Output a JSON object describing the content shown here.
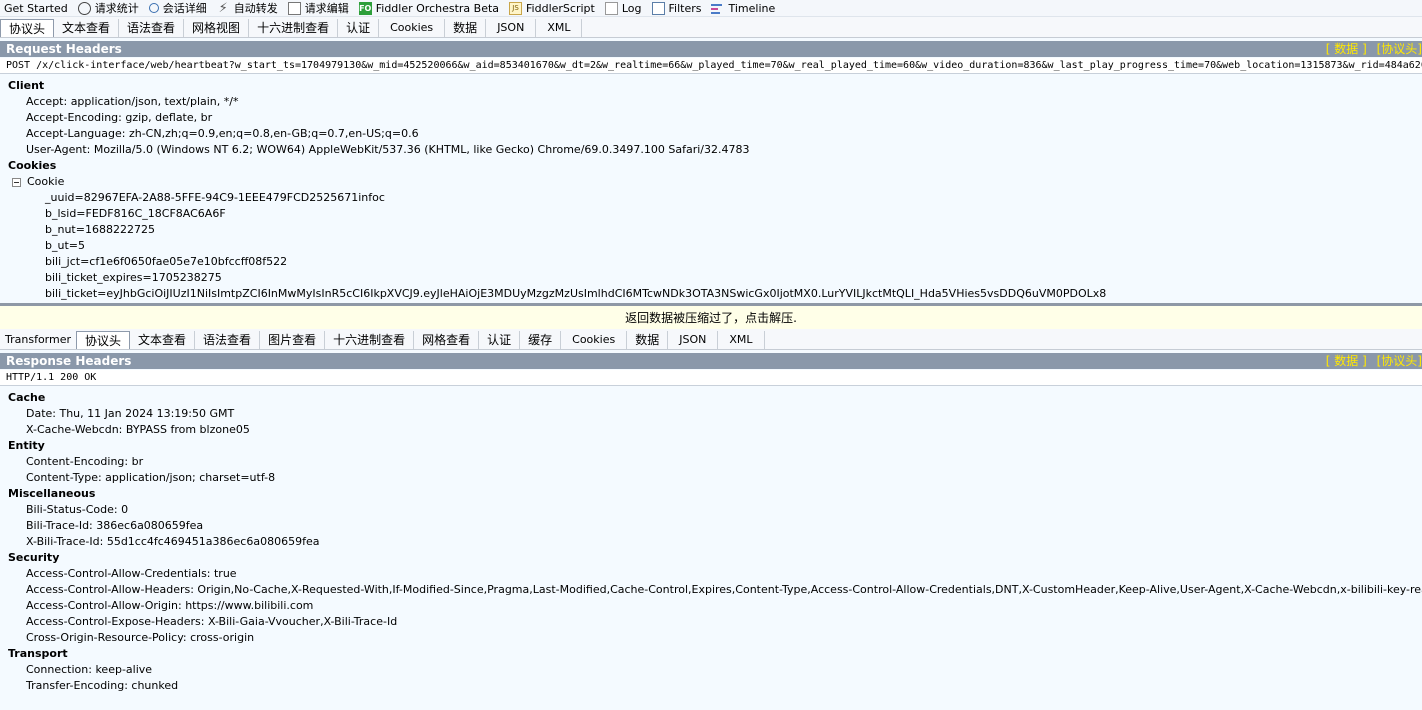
{
  "toolbar": {
    "tabs": [
      {
        "label": "Get Started",
        "icon": "none"
      },
      {
        "label": "请求统计",
        "icon": "clock-icon"
      },
      {
        "label": "会话详细",
        "icon": "inspect-icon"
      },
      {
        "label": "自动转发",
        "icon": "lightning-icon"
      },
      {
        "label": "请求编辑",
        "icon": "compose-icon"
      },
      {
        "label": "Fiddler Orchestra Beta",
        "icon": "fo-icon",
        "icon_text": "FO"
      },
      {
        "label": "FiddlerScript",
        "icon": "script-icon",
        "icon_text": "JS"
      },
      {
        "label": "Log",
        "icon": "log-icon"
      },
      {
        "label": "Filters",
        "icon": "checkbox-icon"
      },
      {
        "label": "Timeline",
        "icon": "timeline-icon"
      }
    ]
  },
  "request": {
    "tabs": [
      "协议头",
      "文本查看",
      "语法查看",
      "网格视图",
      "十六进制查看",
      "认证",
      "Cookies",
      "数据",
      "JSON",
      "XML"
    ],
    "panel_title": "Request Headers",
    "panel_links": [
      "[ 数据 ]",
      "[协议头]"
    ],
    "request_line": "POST /x/click-interface/web/heartbeat?w_start_ts=1704979130&w_mid=452520066&w_aid=853401670&w_dt=2&w_realtime=66&w_played_time=70&w_real_played_time=60&w_video_duration=836&w_last_play_progress_time=70&web_location=1315873&w_rid=484a620",
    "client": {
      "title": "Client",
      "rows": [
        "Accept: application/json, text/plain, */*",
        "Accept-Encoding: gzip, deflate, br",
        "Accept-Language: zh-CN,zh;q=0.9,en;q=0.8,en-GB;q=0.7,en-US;q=0.6",
        "User-Agent: Mozilla/5.0 (Windows NT 6.2; WOW64) AppleWebKit/537.36 (KHTML, like Gecko) Chrome/69.0.3497.100 Safari/32.4783"
      ]
    },
    "cookies": {
      "title": "Cookies",
      "node": "Cookie",
      "items": [
        "_uuid=82967EFA-2A88-5FFE-94C9-1EEE479FCD2525671infoc",
        "b_lsid=FEDF816C_18CF8AC6A6F",
        "b_nut=1688222725",
        "b_ut=5",
        "bili_jct=cf1e6f0650fae05e7e10bfccff08f522",
        "bili_ticket_expires=1705238275",
        "bili_ticket=eyJhbGciOiJIUzI1NiIsImtpZCI6InMwMyIsInR5cCI6IkpXVCJ9.eyJleHAiOjE3MDUyMzgzMzUsImlhdCI6MTcwNDk3OTA3NSwicGx0IjotMX0.LurYVILJkctMtQLI_Hda5VHies5vsDDQ6uVM0PDOLx8"
      ]
    }
  },
  "notice": "返回数据被压缩过了，点击解压.",
  "response": {
    "tabs": [
      "Transformer",
      "协议头",
      "文本查看",
      "语法查看",
      "图片查看",
      "十六进制查看",
      "网格查看",
      "认证",
      "缓存",
      "Cookies",
      "数据",
      "JSON",
      "XML"
    ],
    "panel_title": "Response Headers",
    "panel_links": [
      "[ 数据 ]",
      "[协议头]"
    ],
    "status_line": "HTTP/1.1 200 OK",
    "groups": [
      {
        "title": "Cache",
        "rows": [
          "Date: Thu, 11 Jan 2024 13:19:50 GMT",
          "X-Cache-Webcdn: BYPASS from blzone05"
        ]
      },
      {
        "title": "Entity",
        "rows": [
          "Content-Encoding: br",
          "Content-Type: application/json; charset=utf-8"
        ]
      },
      {
        "title": "Miscellaneous",
        "rows": [
          "Bili-Status-Code: 0",
          "Bili-Trace-Id: 386ec6a080659fea",
          "X-Bili-Trace-Id: 55d1cc4fc469451a386ec6a080659fea"
        ]
      },
      {
        "title": "Security",
        "rows": [
          "Access-Control-Allow-Credentials: true",
          "Access-Control-Allow-Headers: Origin,No-Cache,X-Requested-With,If-Modified-Since,Pragma,Last-Modified,Cache-Control,Expires,Content-Type,Access-Control-Allow-Credentials,DNT,X-CustomHeader,Keep-Alive,User-Agent,X-Cache-Webcdn,x-bilibili-key-real-ip,x-backend...",
          "Access-Control-Allow-Origin: https://www.bilibili.com",
          "Access-Control-Expose-Headers: X-Bili-Gaia-Vvoucher,X-Bili-Trace-Id",
          "Cross-Origin-Resource-Policy: cross-origin"
        ]
      },
      {
        "title": "Transport",
        "rows": [
          "Connection: keep-alive",
          "Transfer-Encoding: chunked"
        ]
      }
    ]
  }
}
